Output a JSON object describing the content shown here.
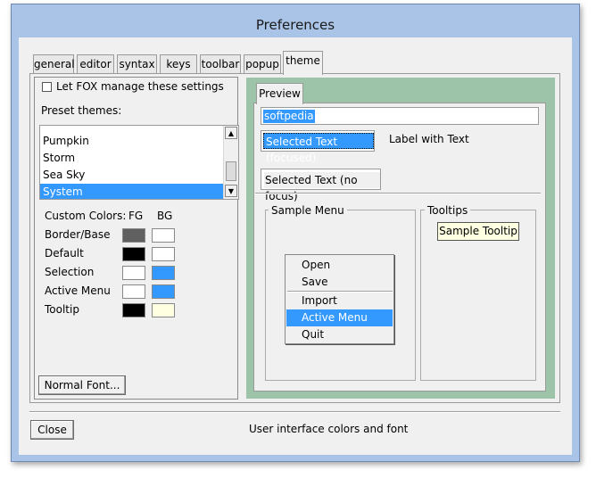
{
  "window": {
    "title": "Preferences"
  },
  "tabs": [
    {
      "label": "general"
    },
    {
      "label": "editor"
    },
    {
      "label": "syntax"
    },
    {
      "label": "keys"
    },
    {
      "label": "toolbar"
    },
    {
      "label": "popup"
    },
    {
      "label": "theme",
      "active": true
    }
  ],
  "theme": {
    "fox_manage_label": "Let FOX manage these settings",
    "fox_manage_checked": false,
    "preset_label": "Preset themes:",
    "presets": [
      "Pumpkin",
      "Storm",
      "Sea Sky",
      "System"
    ],
    "selected_preset": "System",
    "custom_colors_label": "Custom Colors:",
    "fg_label": "FG",
    "bg_label": "BG",
    "color_rows": [
      {
        "label": "Border/Base",
        "fg": "#606060",
        "bg": "#ffffff"
      },
      {
        "label": "Default",
        "fg": "#000000",
        "bg": "#ffffff"
      },
      {
        "label": "Selection",
        "fg": "#ffffff",
        "bg": "#3399ff"
      },
      {
        "label": "Active Menu",
        "fg": "#ffffff",
        "bg": "#3399ff"
      },
      {
        "label": "Tooltip",
        "fg": "#000000",
        "bg": "#ffffe1"
      }
    ],
    "normal_font_button": "Normal Font..."
  },
  "preview": {
    "tab_label": "Preview",
    "text_field_value": "softpedia",
    "selected_focused": "Selected Text (focused)",
    "label_with_text": "Label with Text",
    "selected_no_focus": "Selected Text (no focus)",
    "sample_menu_title": "Sample Menu",
    "menu_items": [
      "Open",
      "Save",
      "Import",
      "Active Menu Item",
      "Quit"
    ],
    "tooltips_title": "Tooltips",
    "sample_tooltip": "Sample Tooltip"
  },
  "footer": {
    "close_button": "Close",
    "status_text": "User interface colors and font"
  },
  "colors": {
    "accent": "#3399ff",
    "frame_green": "#9dc4a8",
    "window_border": "#a9c4e6"
  }
}
